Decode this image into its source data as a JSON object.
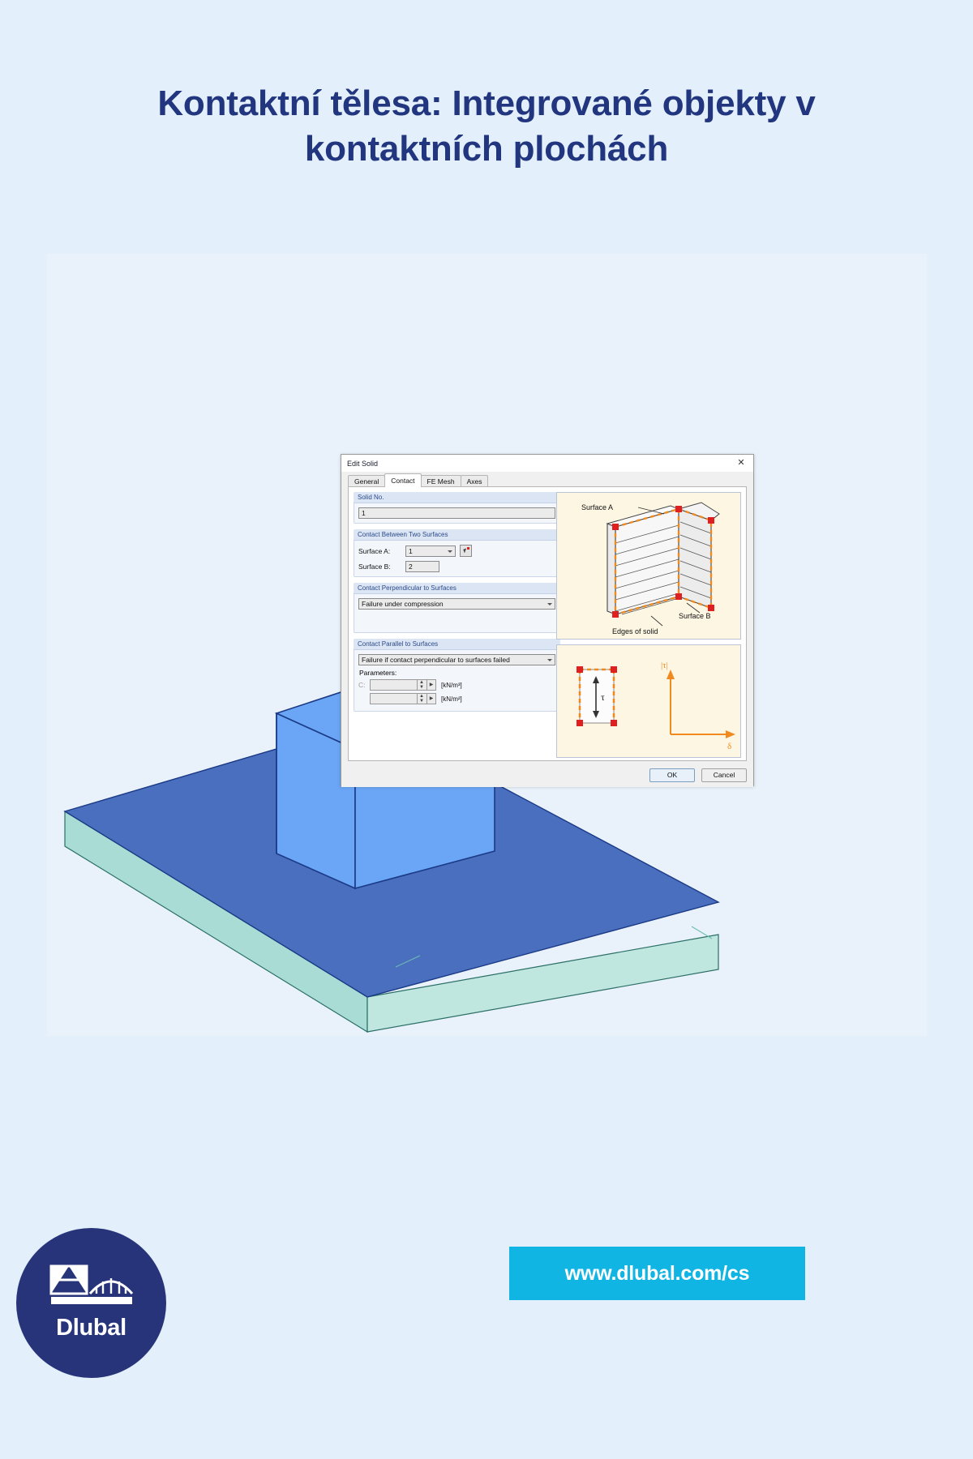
{
  "page": {
    "title": "Kontaktní tělesa: Integrované objekty v kontaktních plochách",
    "background_color": "#e3f0fc",
    "title_color": "#22357f"
  },
  "dialog": {
    "title": "Edit Solid",
    "close_icon": "close-icon",
    "tabs": [
      {
        "label": "General",
        "active": false
      },
      {
        "label": "Contact",
        "active": true
      },
      {
        "label": "FE Mesh",
        "active": false
      },
      {
        "label": "Axes",
        "active": false
      }
    ],
    "groups": {
      "solid_no": {
        "header": "Solid No.",
        "value": "1"
      },
      "contact_between": {
        "header": "Contact Between Two Surfaces",
        "surface_a_label": "Surface A:",
        "surface_a_value": "1",
        "surface_b_label": "Surface B:",
        "surface_b_value": "2",
        "pick_icon": "pick-surface-icon"
      },
      "perpendicular": {
        "header": "Contact Perpendicular to Surfaces",
        "value": "Failure under compression"
      },
      "parallel": {
        "header": "Contact Parallel to Surfaces",
        "value": "Failure if contact perpendicular to surfaces failed",
        "parameters_label": "Parameters:",
        "params": [
          {
            "key": "C:",
            "value": "",
            "unit": "[kN/m³]"
          },
          {
            "key": "",
            "value": "",
            "unit": "[kN/m²]"
          }
        ]
      }
    },
    "diagram_top": {
      "labels": {
        "surface_a": "Surface A",
        "surface_b": "Surface B",
        "edges_of_solid": "Edges of solid"
      },
      "accent_color": "#f08a1e",
      "node_color": "#e02020",
      "background_color": "#fdf6e3"
    },
    "diagram_bottom": {
      "labels": {
        "tau_axis": "|τ|",
        "delta_axis": "δ",
        "tau_symbol": "τ"
      },
      "accent_color": "#f08a1e"
    },
    "buttons": {
      "ok": "OK",
      "cancel": "Cancel"
    }
  },
  "model": {
    "plate_top_color": "#4a6fbf",
    "plate_side_color": "#a9dcd4",
    "block_color": "#6aa6f5",
    "block_top_color": "#9cc8fb",
    "edge_color": "#1b3a86"
  },
  "footer": {
    "logo_text": "Dlubal",
    "logo_icon": "dlubal-bridge-icon",
    "url": "www.dlubal.com/cs",
    "url_bar_color": "#11b5e4",
    "logo_bg_color": "#27347a"
  }
}
